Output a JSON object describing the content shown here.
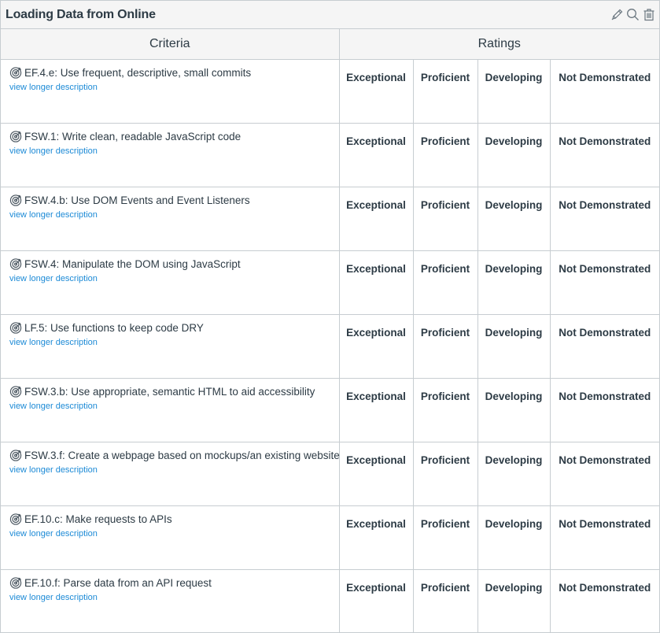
{
  "rubric": {
    "title": "Loading Data from Online",
    "actions": [
      {
        "name": "edit",
        "icon": "pencil-icon"
      },
      {
        "name": "search",
        "icon": "search-icon"
      },
      {
        "name": "delete",
        "icon": "trash-icon"
      }
    ],
    "headers": {
      "criteria": "Criteria",
      "ratings": "Ratings"
    },
    "ratings_labels": [
      "Exceptional",
      "Proficient",
      "Developing",
      "Not Demonstrated"
    ],
    "link_label": "view longer description",
    "criteria": [
      {
        "description": "EF.4.e: Use frequent, descriptive, small commits",
        "icon": "outcome-target-icon"
      },
      {
        "description": "FSW.1: Write clean, readable JavaScript code",
        "icon": "outcome-target-icon"
      },
      {
        "description": "FSW.4.b: Use DOM Events and Event Listeners",
        "icon": "outcome-target-icon"
      },
      {
        "description": "FSW.4: Manipulate the DOM using JavaScript",
        "icon": "outcome-target-icon"
      },
      {
        "description": "LF.5: Use functions to keep code DRY",
        "icon": "outcome-target-icon"
      },
      {
        "description": "FSW.3.b: Use appropriate, semantic HTML to aid accessibility",
        "icon": "outcome-target-icon"
      },
      {
        "description": "FSW.3.f: Create a webpage based on mockups/an existing website",
        "icon": "outcome-target-icon"
      },
      {
        "description": "EF.10.c: Make requests to APIs",
        "icon": "outcome-target-icon"
      },
      {
        "description": "EF.10.f: Parse data from an API request",
        "icon": "outcome-target-icon"
      }
    ],
    "colors": {
      "text": "#2d3b45",
      "link": "#1c8ad6",
      "border": "#c7cdd1",
      "header_bg": "#f5f5f5"
    }
  }
}
